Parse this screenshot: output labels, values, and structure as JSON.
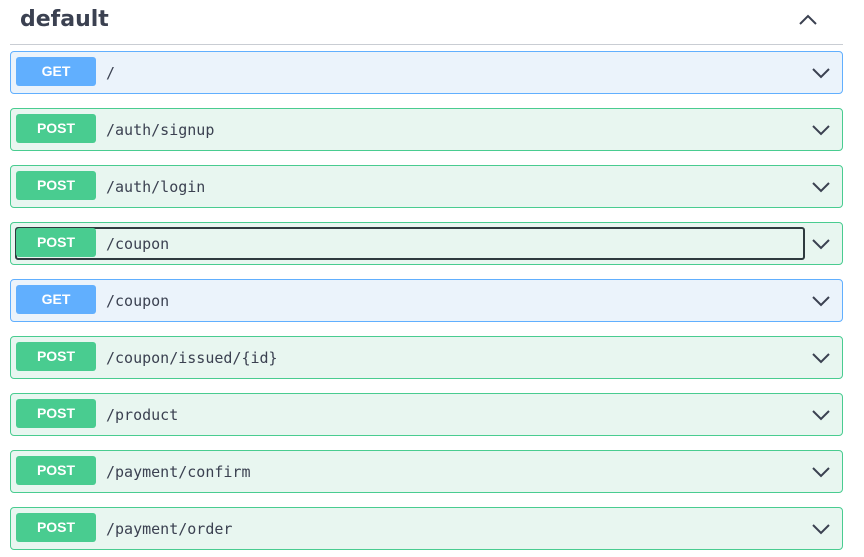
{
  "section": {
    "title": "default",
    "toggle_icon": "chevron-up-icon"
  },
  "operations": [
    {
      "method": "GET",
      "path": "/"
    },
    {
      "method": "POST",
      "path": "/auth/signup"
    },
    {
      "method": "POST",
      "path": "/auth/login"
    },
    {
      "method": "POST",
      "path": "/coupon"
    },
    {
      "method": "GET",
      "path": "/coupon"
    },
    {
      "method": "POST",
      "path": "/coupon/issued/{id}"
    },
    {
      "method": "POST",
      "path": "/product"
    },
    {
      "method": "POST",
      "path": "/payment/confirm"
    },
    {
      "method": "POST",
      "path": "/payment/order"
    }
  ],
  "icons": {
    "expand": "chevron-down-icon"
  },
  "colors": {
    "get": "#61affe",
    "post": "#49cc90",
    "text": "#3b4151"
  }
}
